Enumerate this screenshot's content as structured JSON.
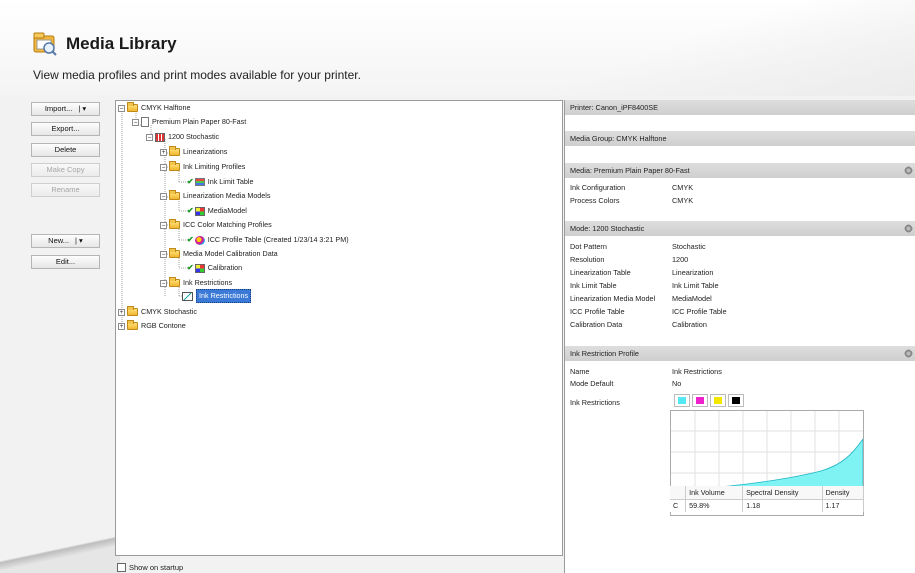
{
  "header": {
    "title": "Media Library",
    "subtitle": "View media profiles and print modes available for your printer."
  },
  "buttons": {
    "import": "Import...",
    "export": "Export...",
    "delete": "Delete",
    "make_copy": "Make Copy",
    "rename": "Rename",
    "new": "New...",
    "edit": "Edit..."
  },
  "tree": {
    "cmyk_halftone": "CMYK Halftone",
    "premium_plain_paper": "Premium Plain Paper 80-Fast",
    "stochastic_1200": "1200 Stochastic",
    "linearizations": "Linearizations",
    "ink_limiting_profiles": "Ink Limiting Profiles",
    "ink_limit_table": "Ink Limit Table",
    "linearization_media_models": "Linearization Media Models",
    "media_model": "MediaModel",
    "icc_color_matching_profiles": "ICC Color Matching Profiles",
    "icc_profile_table": "ICC Profile Table (Created 1/23/14 3:21 PM)",
    "media_model_calibration_data": "Media Model Calibration Data",
    "calibration": "Calibration",
    "ink_restrictions_folder": "Ink Restrictions",
    "ink_restrictions_item": "Ink Restrictions",
    "cmyk_stochastic": "CMYK Stochastic",
    "rgb_contone": "RGB Contone"
  },
  "footer": {
    "show_on_startup": "Show on startup"
  },
  "details": {
    "printer": "Printer: Canon_iPF8400SE",
    "media_group": "Media Group: CMYK Halftone",
    "media": "Media: Premium Plain Paper 80-Fast",
    "media_props": [
      {
        "label": "Ink Configuration",
        "value": "CMYK"
      },
      {
        "label": "Process Colors",
        "value": "CMYK"
      }
    ],
    "mode": "Mode: 1200 Stochastic",
    "mode_props": [
      {
        "label": "Dot Pattern",
        "value": "Stochastic"
      },
      {
        "label": "Resolution",
        "value": "1200"
      },
      {
        "label": "Linearization Table",
        "value": "Linearization"
      },
      {
        "label": "Ink Limit Table",
        "value": "Ink Limit Table"
      },
      {
        "label": "Linearization Media Model",
        "value": "MediaModel"
      },
      {
        "label": "ICC Profile Table",
        "value": "ICC Profile Table"
      },
      {
        "label": "Calibration Data",
        "value": "Calibration"
      }
    ],
    "ink_restriction_profile": "Ink Restriction Profile",
    "ir_props": [
      {
        "label": "Name",
        "value": "Ink Restrictions"
      },
      {
        "label": "Mode Default",
        "value": "No"
      }
    ],
    "ink_restrictions_label": "Ink Restrictions",
    "swatch_colors": [
      "#55e8f2",
      "#ee22cc",
      "#f5e600",
      "#000000"
    ],
    "table_headers": [
      "",
      "Ink Volume",
      "Spectral Density",
      "Density"
    ],
    "table_row": [
      "C",
      "59.8%",
      "1.18",
      "1.17"
    ]
  },
  "colors": {
    "accent": "#3b79d6",
    "curve_fill": "#7ff3f3",
    "curve_stroke": "#1fb5c4"
  },
  "icons": [
    "media-library-icon",
    "folder-icon",
    "document-icon",
    "checkmark-icon",
    "gear-icon"
  ]
}
